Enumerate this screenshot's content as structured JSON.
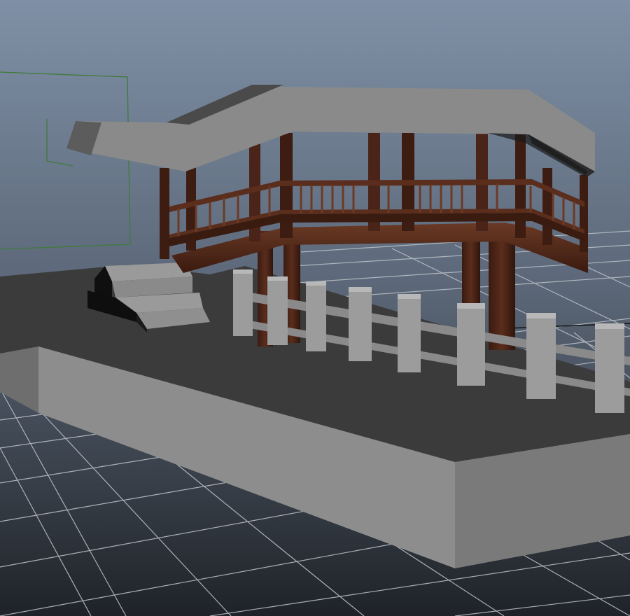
{
  "viewport": {
    "panel": "3d-perspective-viewport",
    "background": {
      "gradient_top": "#7f90a6",
      "gradient_mid": "#5b6778",
      "gradient_bottom": "#20242a"
    },
    "grid": {
      "line_color": "#b9bec5",
      "axis_color": "#111111"
    },
    "camera_frustum_color": "#3f7a3a"
  },
  "scene": {
    "objects": [
      {
        "name": "stone-platform",
        "material_color": "#8d8d8d"
      },
      {
        "name": "entry-steps",
        "material_color": "#8f8f8f"
      },
      {
        "name": "stone-fence",
        "material_color": "#9a9a9a"
      },
      {
        "name": "wooden-pavilion",
        "material_color": "#4a2418"
      },
      {
        "name": "pavilion-roof",
        "material_color": "#8a8a8a"
      }
    ]
  }
}
